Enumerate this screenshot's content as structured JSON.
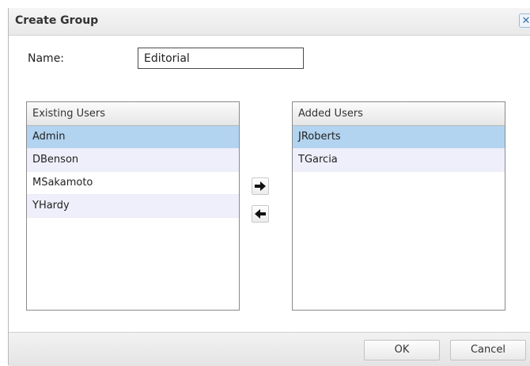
{
  "dialog": {
    "title": "Create Group",
    "close_glyph": "✕"
  },
  "form": {
    "name_label": "Name:",
    "name_value": "Editorial"
  },
  "existing": {
    "header": "Existing Users",
    "items": [
      {
        "label": "Admin",
        "state": "selected"
      },
      {
        "label": "DBenson",
        "state": "alt"
      },
      {
        "label": "MSakamoto",
        "state": "normal"
      },
      {
        "label": "YHardy",
        "state": "alt"
      }
    ]
  },
  "added": {
    "header": "Added Users",
    "items": [
      {
        "label": "JRoberts",
        "state": "selected"
      },
      {
        "label": "TGarcia",
        "state": "alt"
      }
    ]
  },
  "controls": {
    "add_icon": "arrow-right-icon",
    "remove_icon": "arrow-left-icon"
  },
  "footer": {
    "ok_label": "OK",
    "cancel_label": "Cancel"
  },
  "colors": {
    "selected_row": "#b3d4f0",
    "alt_row": "#efeffb",
    "close_accent": "#3a6fa3"
  }
}
